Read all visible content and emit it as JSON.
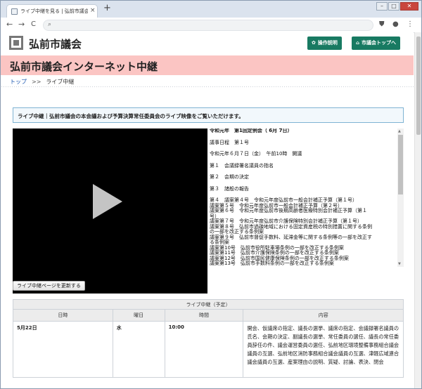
{
  "browser": {
    "tab_title": "ライブ中継を見る | 弘前市議会インタ",
    "tab_close": "×",
    "new_tab": "+",
    "window_controls": [
      "–",
      "□",
      "✕"
    ],
    "nav": {
      "back": "←",
      "forward": "→",
      "reload": "C"
    },
    "url": ""
  },
  "header": {
    "site_name": "弘前市議会",
    "buttons": [
      {
        "label": "操作説明",
        "icon": "gear-icon",
        "icon_glyph": "✿"
      },
      {
        "label": "市議会トップへ",
        "icon": "home-icon",
        "icon_glyph": "⌂"
      }
    ],
    "brand_color": "#187a62"
  },
  "banner": {
    "title": "弘前市議会インターネット中継",
    "bg_color": "#fbc5c3"
  },
  "breadcrumb": {
    "home": "トップ",
    "separator": ">>",
    "current": "ライブ中継"
  },
  "notice": {
    "text": "ライブ中継｜弘前市議会の本会議および予算決算常任委員会のライブ映像をご覧いただけます。"
  },
  "agenda": {
    "lines": [
      "令和元年　第1回定例会（ 6月 7日）",
      "",
      "議事日程　第１号",
      "",
      "令和元年６月７日（金）　午前10時　開議",
      "",
      "第１　会議録署名議員の指名",
      "",
      "第２　会期の決定",
      "",
      "第３　諸般の報告",
      "",
      "第４　議案第４号　令和元年度弘前市一般会計補正予算（第１号）",
      "議案第５号　令和元年度弘前市一般会計補正予算（第２号）",
      "議案第６号　令和元年度弘前市後期高齢者医療特別会計補正予算（第１",
      "号）",
      "議案第７号　令和元年度弘前市介護保険特別会計補正予算（第１号）",
      "議案第８号　弘前市過疎地域における固定資産税の特別措置に関する条例",
      "の一部を改正する条例案",
      "議案第９号　弘前市督促手数料、延滞金等に関する条例等の一部を改正す",
      "る条例案",
      "議案第10号　弘前市役所駐車場条例の一部を改正する条例案",
      "議案第11号　弘前市介護保険条例の一部を改正する条例案",
      "議案第12号　弘前市国民健康保険条例の一部を改正する条例案",
      "議案第13号　弘前市手数料条例の一部を改正する条例案"
    ]
  },
  "refresh_button": "ライブ中継ページを更新する",
  "schedule": {
    "caption": "ライブ中継（予定）",
    "columns": [
      "日時",
      "曜日",
      "時間",
      "内容"
    ],
    "rows": [
      {
        "date": "5月22日",
        "weekday": "水",
        "time": "10:00",
        "content": "開会、仮議席の指定、議長の選挙、議席の指定、会議録署名議員の氏名、会期の決定、副議長の選挙、常任委員の選任、議長の常任委員辞任の件、議会運営委員の選任、弘前地区環境整備事務組合議会議員の互選、弘前地区消防事務組合議会議員の互選、津軽広域連合議会議員の互選、産案理由の説明、質疑、討論、表決、閉会"
      }
    ]
  }
}
